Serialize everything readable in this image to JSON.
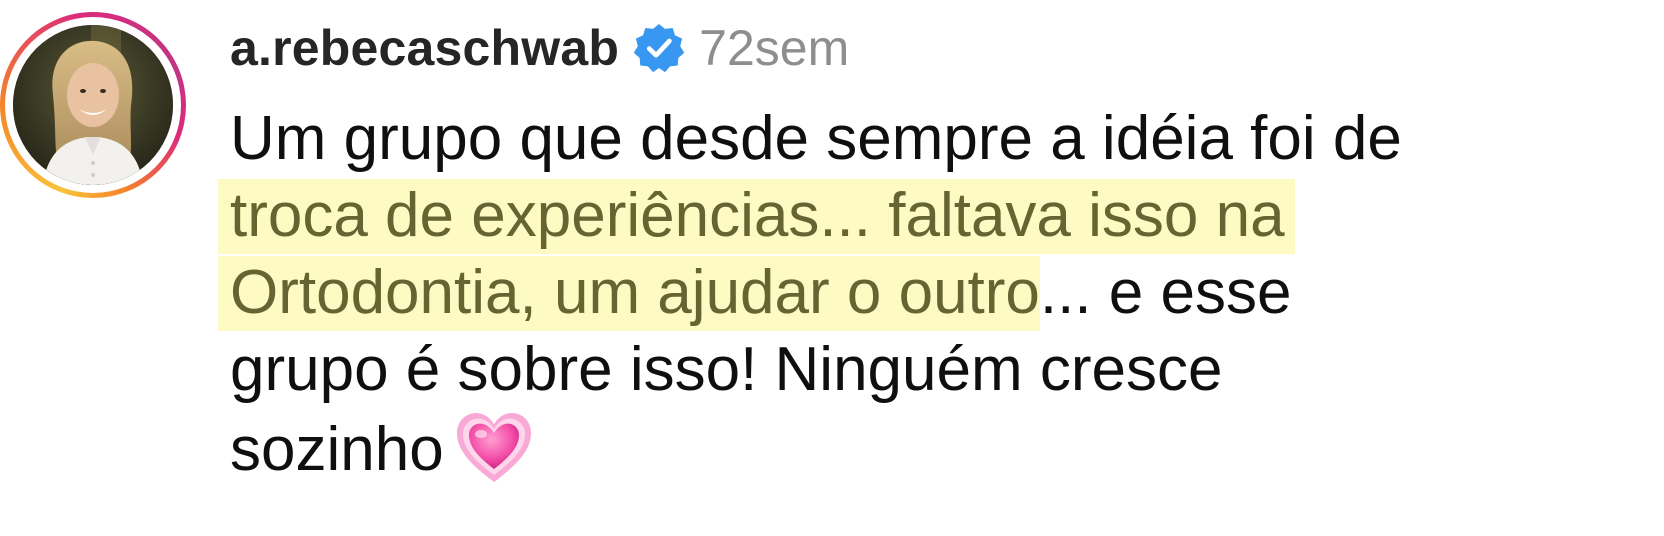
{
  "comment": {
    "author": {
      "username": "a.rebecaschwab",
      "verified": true,
      "avatar_icon": "profile-photo-avatar",
      "story_ring_colors": [
        "#f9c33b",
        "#f58529",
        "#dd2a7b",
        "#c13584"
      ]
    },
    "timestamp": "72sem",
    "text": {
      "line1": "Um grupo que desde sempre a idéia foi de",
      "line2_highlighted": "troca de experiências... faltava isso na",
      "line3_highlighted": "Ortodontia, um ajudar o outro",
      "line3_rest": "... e esse",
      "line4": "grupo é sobre isso! Ninguém cresce",
      "line5": "sozinho",
      "emoji": "growing-heart-emoji"
    },
    "colors": {
      "verified_badge": "#3897f0",
      "highlight_background": "#fdfbc3",
      "highlight_text": "#656433",
      "timestamp": "#8e8e8e",
      "body_text": "#0f0f0f"
    }
  }
}
